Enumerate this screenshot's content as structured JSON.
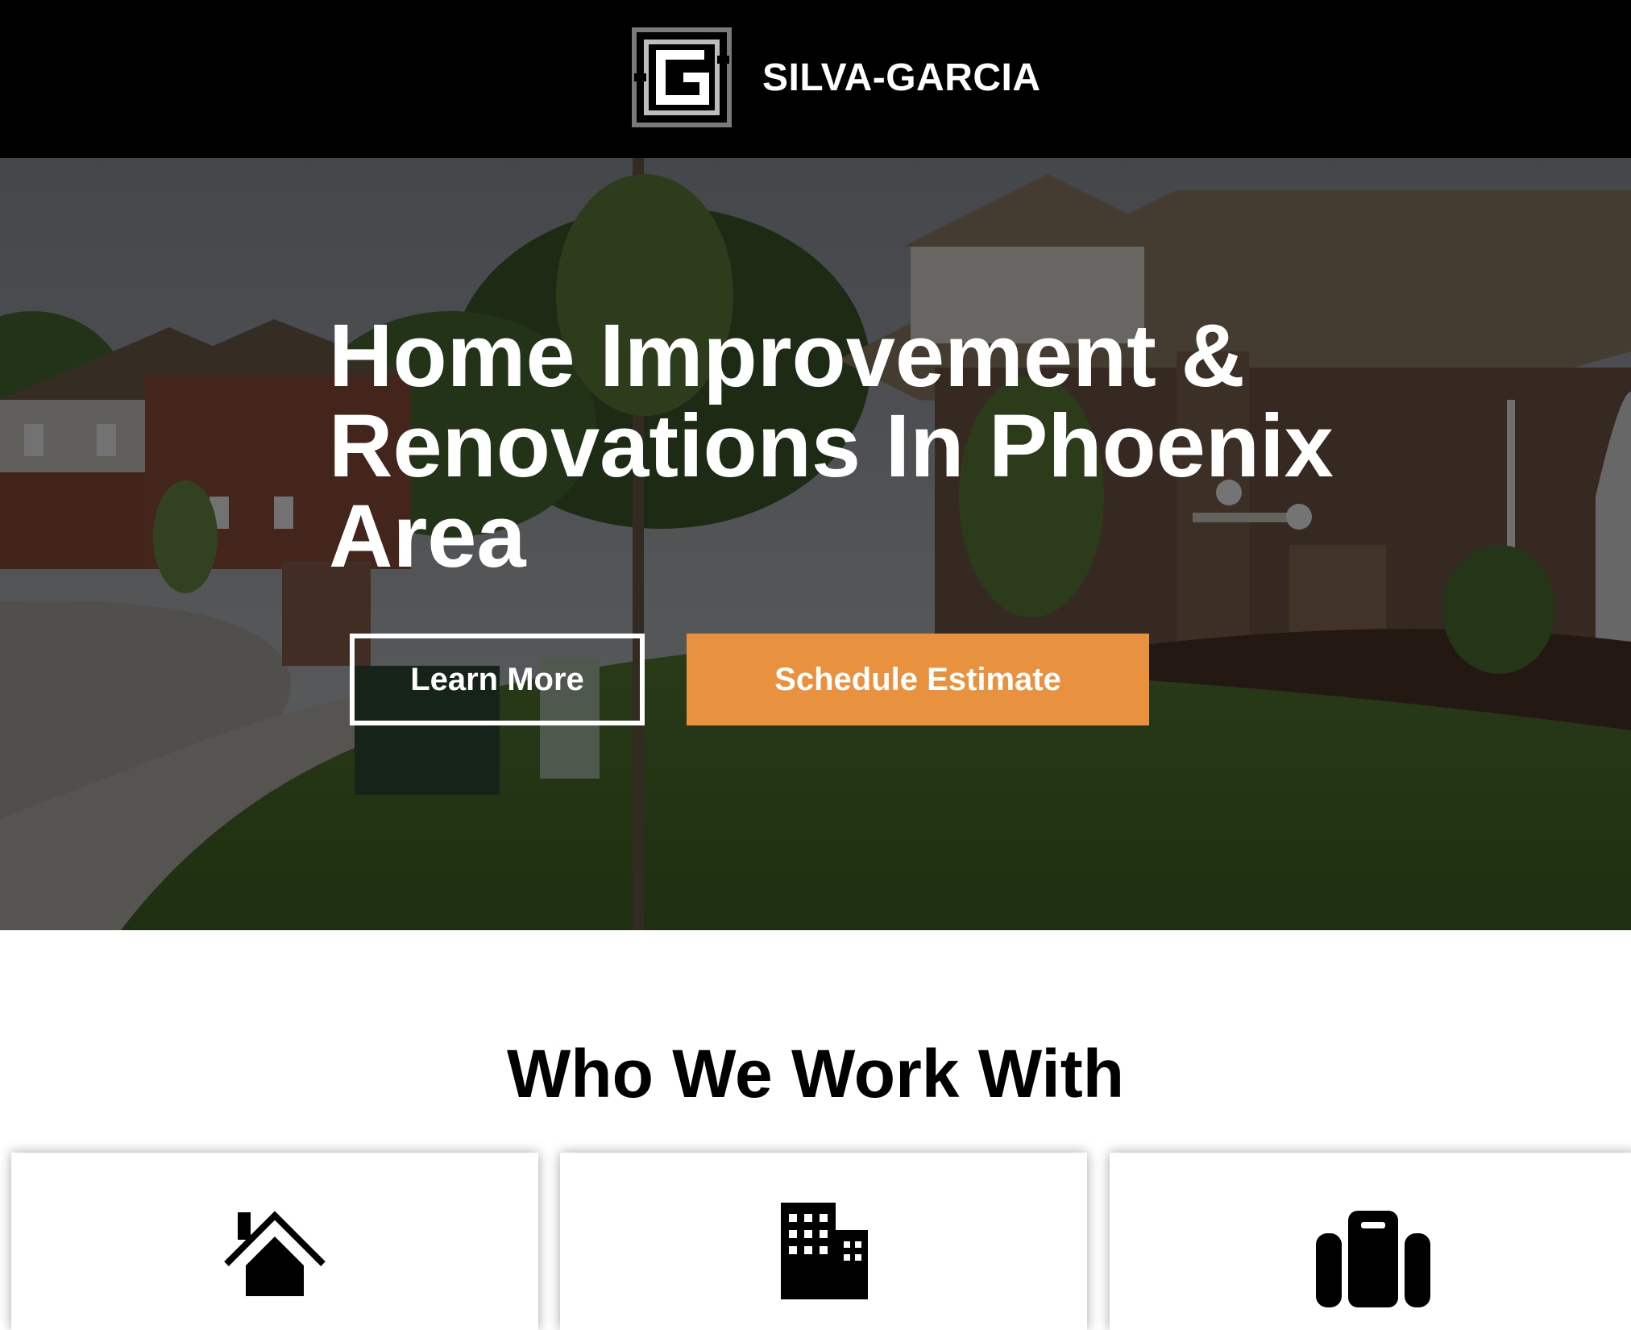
{
  "header": {
    "brand_name": "SILVA-GARCIA",
    "logo_icon": "sg-monogram-logo",
    "background": "#000000"
  },
  "hero": {
    "title": "Home Improvement & Renovations In Phoenix Area",
    "background_image": "suburban-brick-houses-photo",
    "buttons": {
      "learn_more_label": "Learn More",
      "schedule_label": "Schedule Estimate"
    }
  },
  "colors": {
    "accent": "#E8923F",
    "text_dark": "#000000",
    "text_light": "#FFFFFF"
  },
  "who_we_work_with": {
    "title": "Who We Work With",
    "cards": [
      {
        "icon": "house-icon"
      },
      {
        "icon": "building-icon"
      },
      {
        "icon": "luggage-icon"
      }
    ]
  }
}
